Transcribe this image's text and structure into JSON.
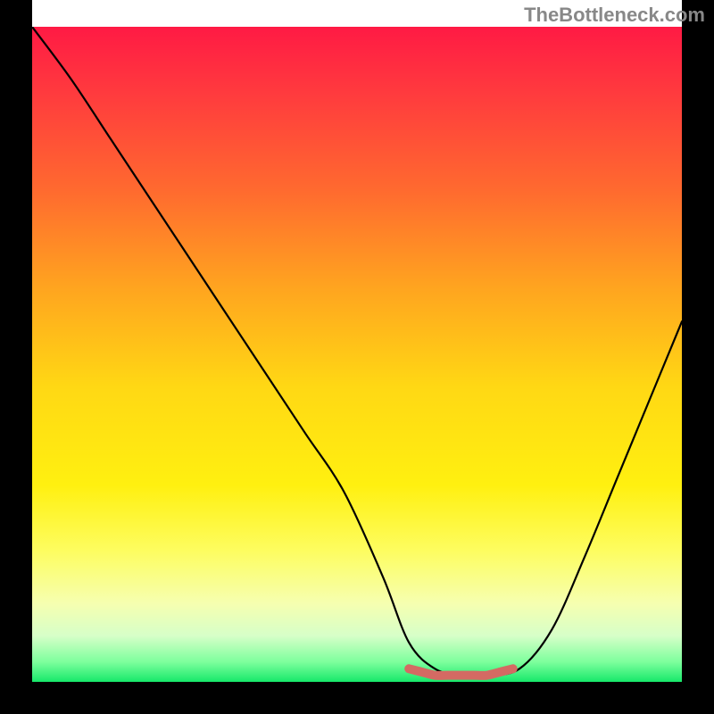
{
  "attribution": "TheBottleneck.com",
  "chart_data": {
    "type": "line",
    "title": "",
    "xlabel": "",
    "ylabel": "",
    "xlim": [
      0,
      100
    ],
    "ylim": [
      0,
      100
    ],
    "series": [
      {
        "name": "bottleneck-curve",
        "x": [
          0,
          6,
          12,
          18,
          24,
          30,
          36,
          42,
          48,
          54,
          58,
          62,
          66,
          70,
          75,
          80,
          85,
          90,
          95,
          100
        ],
        "y": [
          100,
          92,
          83,
          74,
          65,
          56,
          47,
          38,
          29,
          16,
          6,
          2,
          1,
          1,
          2,
          8,
          19,
          31,
          43,
          55
        ]
      },
      {
        "name": "optimal-zone-marker",
        "x": [
          58,
          60,
          62,
          64,
          66,
          68,
          70,
          72,
          74
        ],
        "y": [
          2,
          1.5,
          1,
          1,
          1,
          1,
          1,
          1.5,
          2
        ],
        "color": "#d46a63"
      }
    ],
    "gradient_stops": [
      {
        "pos": 0.0,
        "color": "#ff1a44"
      },
      {
        "pos": 0.1,
        "color": "#ff3a3e"
      },
      {
        "pos": 0.25,
        "color": "#ff6a2f"
      },
      {
        "pos": 0.4,
        "color": "#ffa51f"
      },
      {
        "pos": 0.55,
        "color": "#ffd814"
      },
      {
        "pos": 0.7,
        "color": "#fff010"
      },
      {
        "pos": 0.8,
        "color": "#fdfd60"
      },
      {
        "pos": 0.88,
        "color": "#f6ffb0"
      },
      {
        "pos": 0.93,
        "color": "#d6ffc8"
      },
      {
        "pos": 0.97,
        "color": "#7cff9c"
      },
      {
        "pos": 1.0,
        "color": "#17e86a"
      }
    ]
  }
}
